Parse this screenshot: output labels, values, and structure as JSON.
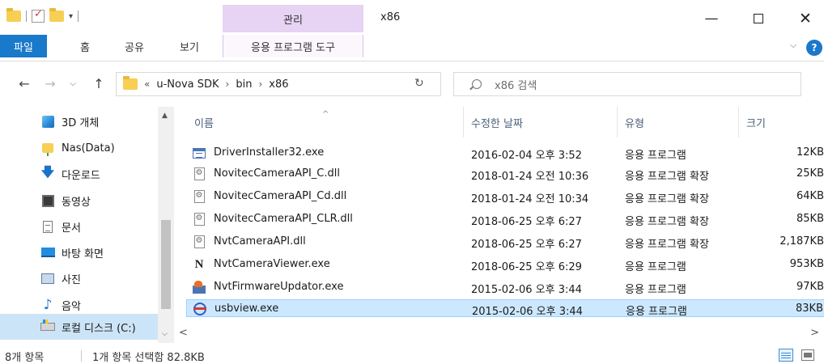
{
  "window": {
    "title": "x86",
    "context_tab": "관리",
    "minimize": "—",
    "close": "✕"
  },
  "ribbon": {
    "tabs": [
      "파일",
      "홈",
      "공유",
      "보기",
      "응용 프로그램 도구"
    ],
    "expand": "⌵",
    "help": "?"
  },
  "nav": {
    "back": "←",
    "forward": "→",
    "recent": "⌵",
    "up": "↑",
    "overflow": "«",
    "breadcrumb": [
      "u-Nova SDK",
      "bin",
      "x86"
    ],
    "breadcrumb_sep": "›",
    "dropdown": "⌵",
    "refresh": "↻",
    "search_placeholder": "x86 검색"
  },
  "sidebar": {
    "items": [
      {
        "label": "3D 개체",
        "icon": "3d-objects-icon"
      },
      {
        "label": "Nas(Data)",
        "icon": "network-drive-icon"
      },
      {
        "label": "다운로드",
        "icon": "downloads-icon"
      },
      {
        "label": "동영상",
        "icon": "videos-icon"
      },
      {
        "label": "문서",
        "icon": "documents-icon"
      },
      {
        "label": "바탕 화면",
        "icon": "desktop-icon"
      },
      {
        "label": "사진",
        "icon": "pictures-icon"
      },
      {
        "label": "음악",
        "icon": "music-icon"
      },
      {
        "label": "로컬 디스크 (C:)",
        "icon": "local-disk-icon"
      }
    ],
    "scroll_up": "▲",
    "scroll_down": "⌵"
  },
  "table": {
    "columns": {
      "name": "이름",
      "date": "수정한 날짜",
      "type": "유형",
      "size": "크기"
    },
    "sort_indicator": "^",
    "rows": [
      {
        "name": "DriverInstaller32.exe",
        "date": "2016-02-04 오후 3:52",
        "type": "응용 프로그램",
        "size": "12KB",
        "icon": "exe-icon"
      },
      {
        "name": "NovitecCameraAPI_C.dll",
        "date": "2018-01-24 오전 10:36",
        "type": "응용 프로그램 확장",
        "size": "25KB",
        "icon": "dll-icon"
      },
      {
        "name": "NovitecCameraAPI_Cd.dll",
        "date": "2018-01-24 오전 10:34",
        "type": "응용 프로그램 확장",
        "size": "64KB",
        "icon": "dll-icon"
      },
      {
        "name": "NovitecCameraAPI_CLR.dll",
        "date": "2018-06-25 오후 6:27",
        "type": "응용 프로그램 확장",
        "size": "85KB",
        "icon": "dll-icon"
      },
      {
        "name": "NvtCameraAPI.dll",
        "date": "2018-06-25 오후 6:27",
        "type": "응용 프로그램 확장",
        "size": "2,187KB",
        "icon": "dll-icon"
      },
      {
        "name": "NvtCameraViewer.exe",
        "date": "2018-06-25 오후 6:29",
        "type": "응용 프로그램",
        "size": "953KB",
        "icon": "n-app-icon"
      },
      {
        "name": "NvtFirmwareUpdator.exe",
        "date": "2015-02-06 오후 3:44",
        "type": "응용 프로그램",
        "size": "97KB",
        "icon": "installer-icon"
      },
      {
        "name": "usbview.exe",
        "date": "2015-02-06 오후 3:44",
        "type": "응용 프로그램",
        "size": "83KB",
        "icon": "usb-icon",
        "selected": true
      }
    ],
    "scroll_left": "<",
    "scroll_right": ">"
  },
  "status": {
    "item_count": "8개 항목",
    "selection": "1개 항목 선택함 82.8KB"
  },
  "colors": {
    "accent": "#1979ca",
    "context_tab_bg": "#e7d3f3",
    "selected_row_bg": "#cce8ff",
    "selected_nav_bg": "#cce4f7"
  }
}
